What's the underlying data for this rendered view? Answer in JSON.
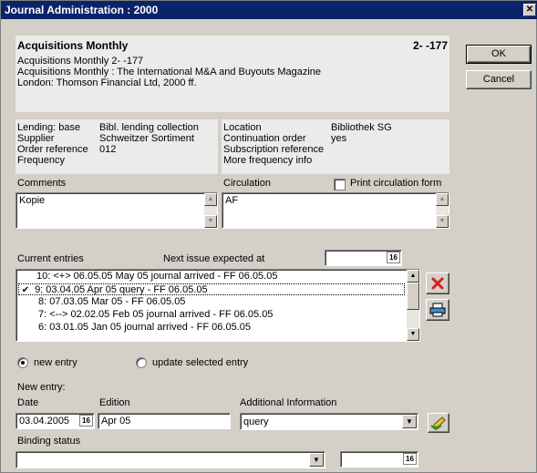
{
  "window": {
    "title": "Journal Administration : 2000",
    "close_glyph": "✕"
  },
  "header": {
    "journal_title": "Acquisitions Monthly",
    "journal_id": "2- -177",
    "info_lines": [
      "Acquisitions Monthly 2- -177",
      "Acquisitions Monthly : The International M&A and Buyouts Magazine",
      "London: Thomson Financial Ltd, 2000 ff."
    ]
  },
  "buttons": {
    "ok": "OK",
    "cancel": "Cancel"
  },
  "details_left": {
    "labels": [
      "Lending: base",
      "Supplier",
      "Order reference",
      "Frequency"
    ],
    "values": [
      "Bibl. lending collection",
      "Schweitzer Sortiment",
      "012",
      ""
    ]
  },
  "details_right": {
    "labels": [
      "Location",
      "Continuation order",
      "Subscription reference",
      "More frequency info"
    ],
    "values": [
      "Bibliothek SG",
      "yes",
      "",
      ""
    ]
  },
  "comments": {
    "label": "Comments",
    "value": "Kopie"
  },
  "circulation": {
    "label": "Circulation",
    "value": "AF",
    "print_label": "Print circulation form",
    "print_checked": false
  },
  "entries": {
    "label": "Current entries",
    "next_issue_label": "Next issue expected at",
    "next_issue_value": "",
    "items": [
      {
        "mark": "",
        "text": "10: <+> 06.05.05 May 05 journal arrived - FF 06.05.05"
      },
      {
        "mark": "✔",
        "text": "9: 03.04.05 Apr 05 query - FF 06.05.05"
      },
      {
        "mark": "",
        "text": "8: 07.03.05 Mar 05  - FF 06.05.05"
      },
      {
        "mark": "",
        "text": "7: <--> 02.02.05 Feb 05 journal arrived - FF 06.05.05"
      },
      {
        "mark": "",
        "text": "6: 03.01.05 Jan 05 journal arrived - FF 06.05.05"
      }
    ],
    "selected_index": 1
  },
  "mode": {
    "new_entry": "new entry",
    "update_selected": "update selected entry",
    "selected": "new_entry"
  },
  "new_entry": {
    "label": "New entry:",
    "date_label": "Date",
    "date_value": "03.04.2005",
    "edition_label": "Edition",
    "edition_value": "Apr 05",
    "additional_label": "Additional Information",
    "additional_value": "query",
    "binding_label": "Binding status",
    "binding_value": "",
    "binding_date_value": ""
  },
  "calendar_icon_text": "16",
  "colors": {
    "title_bar": "#0a246a",
    "dialog_bg": "#d4d0c8",
    "info_bg": "#ebebeb",
    "delete_red": "#d42020"
  }
}
